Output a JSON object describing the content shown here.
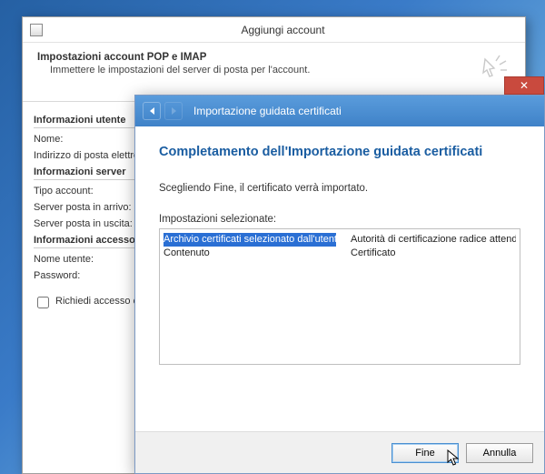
{
  "outer": {
    "title": "Aggiungi account",
    "header_title": "Impostazioni account POP e IMAP",
    "header_sub": "Immettere le impostazioni del server di posta per l'account.",
    "sections": {
      "user": "Informazioni utente",
      "server": "Informazioni server",
      "access": "Informazioni accesso"
    },
    "fields": {
      "name": "Nome:",
      "email": "Indirizzo di posta elettronica:",
      "acct_type": "Tipo account:",
      "incoming": "Server posta in arrivo:",
      "outgoing": "Server posta in uscita:",
      "username": "Nome utente:",
      "password": "Password:"
    },
    "spa": "Richiedi accesso con autenticazione password di protezione (SPA)"
  },
  "wizard": {
    "title": "Importazione guidata certificati",
    "heading": "Completamento dell'Importazione guidata certificati",
    "paragraph": "Scegliendo Fine, il certificato verrà importato.",
    "settings_label": "Impostazioni selezionate:",
    "rows": [
      {
        "k": "Archivio certificati selezionato dall'utente",
        "v": "Autorità di certificazione radice attendibili"
      },
      {
        "k": "Contenuto",
        "v": "Certificato"
      }
    ],
    "btn_finish": "Fine",
    "btn_cancel": "Annulla"
  }
}
